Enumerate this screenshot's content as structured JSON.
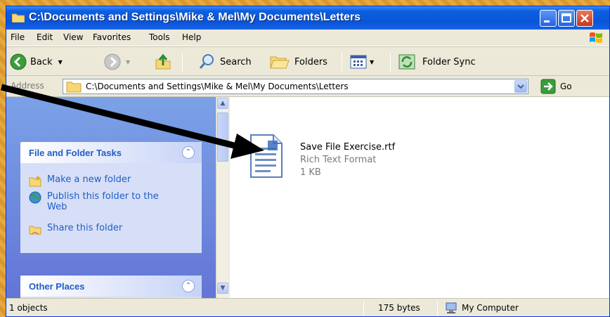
{
  "window": {
    "title": "C:\\Documents and Settings\\Mike & Mel\\My Documents\\Letters"
  },
  "menu": [
    "File",
    "Edit",
    "View",
    "Favorites",
    "Tools",
    "Help"
  ],
  "toolbar": {
    "back_label": "Back",
    "search_label": "Search",
    "folders_label": "Folders",
    "folder_sync_label": "Folder Sync"
  },
  "address": {
    "label": "Address",
    "value": "C:\\Documents and Settings\\Mike & Mel\\My Documents\\Letters",
    "go_label": "Go"
  },
  "tasks_panel": {
    "title": "File and Folder Tasks",
    "items": [
      {
        "label": "Make a new folder"
      },
      {
        "label": "Publish this folder to the Web"
      },
      {
        "label": "Share this folder"
      }
    ]
  },
  "places_panel": {
    "title": "Other Places"
  },
  "file": {
    "name": "Save File Exercise.rtf",
    "type": "Rich Text Format",
    "size": "1 KB"
  },
  "status": {
    "objects": "1 objects",
    "bytes": "175 bytes",
    "location": "My Computer"
  },
  "colors": {
    "titlebar": "#0a55d8",
    "task_link": "#215dc6",
    "background": "#e6a941"
  }
}
